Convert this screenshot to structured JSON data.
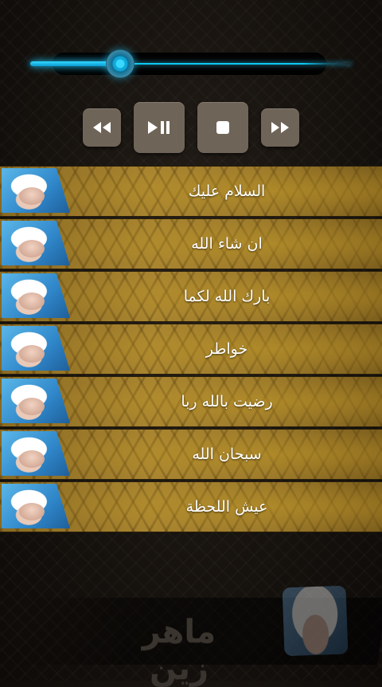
{
  "player": {
    "progress": 0.28,
    "controls": [
      "rewind-icon",
      "play-pause-icon",
      "stop-icon",
      "fast-forward-icon"
    ]
  },
  "tracks": [
    {
      "title": "السلام عليك"
    },
    {
      "title": "ان شاء الله"
    },
    {
      "title": "بارك الله لكما"
    },
    {
      "title": "خواطر"
    },
    {
      "title": "رضيت بالله ربا"
    },
    {
      "title": "سبحان الله"
    },
    {
      "title": "عيش اللحظة"
    }
  ],
  "brand": {
    "name": "ماهر زين"
  },
  "colors": {
    "accent": "#16b7e5",
    "button": "#6f6458",
    "row_gold": "#a98530"
  }
}
